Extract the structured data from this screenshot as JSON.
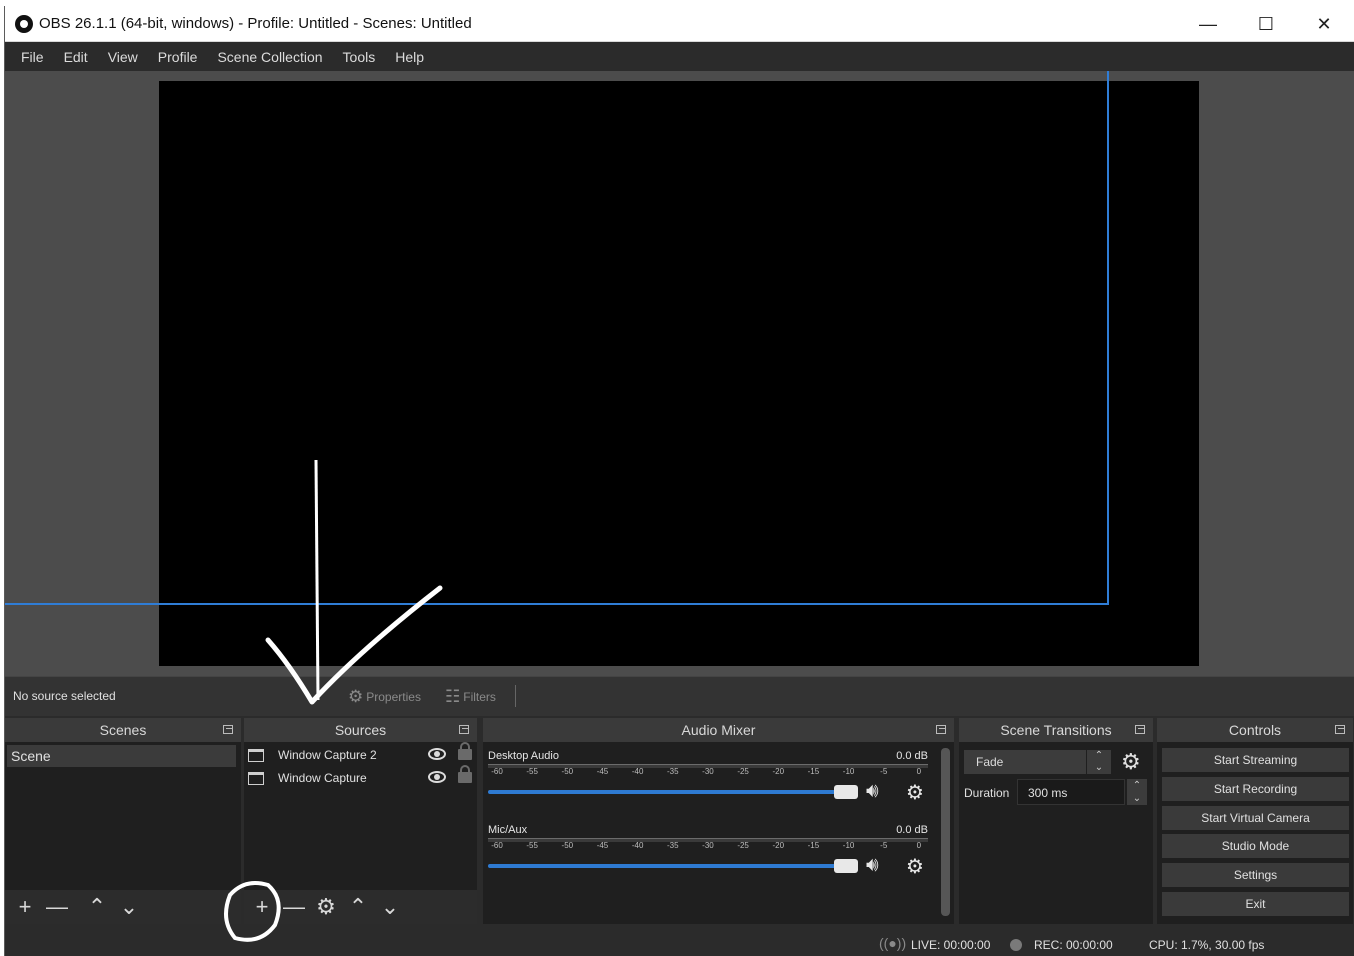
{
  "window": {
    "title": "OBS 26.1.1 (64-bit, windows) - Profile: Untitled - Scenes: Untitled",
    "minimize": "—",
    "maximize": "☐",
    "close": "✕"
  },
  "menu": [
    "File",
    "Edit",
    "View",
    "Profile",
    "Scene Collection",
    "Tools",
    "Help"
  ],
  "source_toolbar": {
    "status": "No source selected",
    "properties": "Properties",
    "filters": "Filters"
  },
  "scenes": {
    "title": "Scenes",
    "items": [
      "Scene"
    ]
  },
  "sources": {
    "title": "Sources",
    "items": [
      "Window Capture 2",
      "Window Capture"
    ]
  },
  "audio_mixer": {
    "title": "Audio Mixer",
    "ticks": [
      "-60",
      "-55",
      "-50",
      "-45",
      "-40",
      "-35",
      "-30",
      "-25",
      "-20",
      "-15",
      "-10",
      "-5",
      "0"
    ],
    "channels": [
      {
        "name": "Desktop Audio",
        "level": "0.0 dB"
      },
      {
        "name": "Mic/Aux",
        "level": "0.0 dB"
      }
    ]
  },
  "transitions": {
    "title": "Scene Transitions",
    "selected": "Fade",
    "duration_label": "Duration",
    "duration_value": "300 ms"
  },
  "controls": {
    "title": "Controls",
    "buttons": [
      "Start Streaming",
      "Start Recording",
      "Start Virtual Camera",
      "Studio Mode",
      "Settings",
      "Exit"
    ]
  },
  "status": {
    "live": "LIVE: 00:00:00",
    "rec": "REC: 00:00:00",
    "cpu": "CPU: 1.7%, 30.00 fps"
  },
  "colors": {
    "selection": "#2f7dd6",
    "annotation": "#ffffff"
  }
}
